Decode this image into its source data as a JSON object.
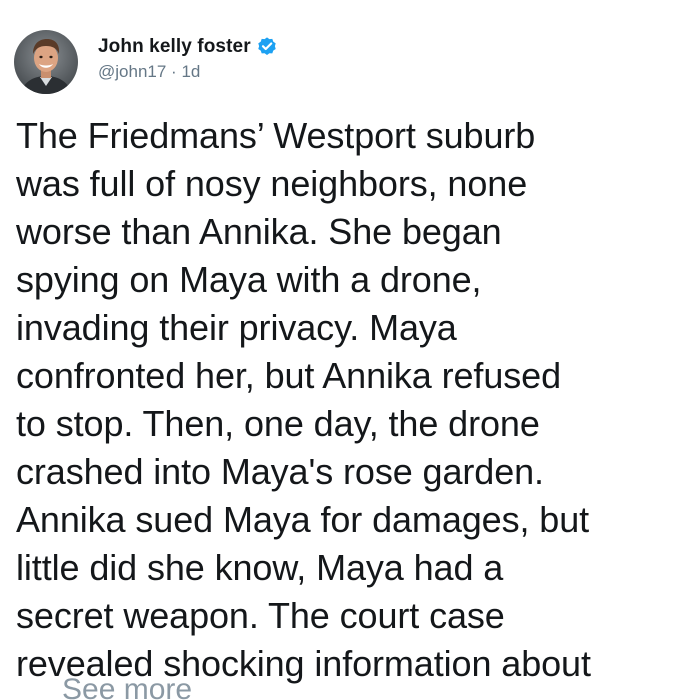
{
  "author": {
    "display_name": "John kelly foster",
    "handle": "@john17",
    "separator": "·",
    "age": "1d",
    "verified": true,
    "avatar_icon": "profile-photo-icon",
    "badge_icon": "verified-badge-icon",
    "badge_color": "#1da1f2"
  },
  "tweet": {
    "text": "The Friedmans’ Westport suburb\nwas full of nosy neighbors, none\nworse than Annika. She began\nspying on Maya with a drone,\ninvading their privacy. Maya\nconfronted her, but Annika refused\nto stop. Then, one day, the drone\ncrashed into Maya's rose garden.\nAnnika sued Maya for damages, but\nlittle did she know, Maya had a\nsecret weapon. The court case\nrevealed shocking information about",
    "see_more_label": "See more"
  },
  "colors": {
    "text_primary": "#14171a",
    "text_secondary": "#657786",
    "background": "#ffffff"
  }
}
